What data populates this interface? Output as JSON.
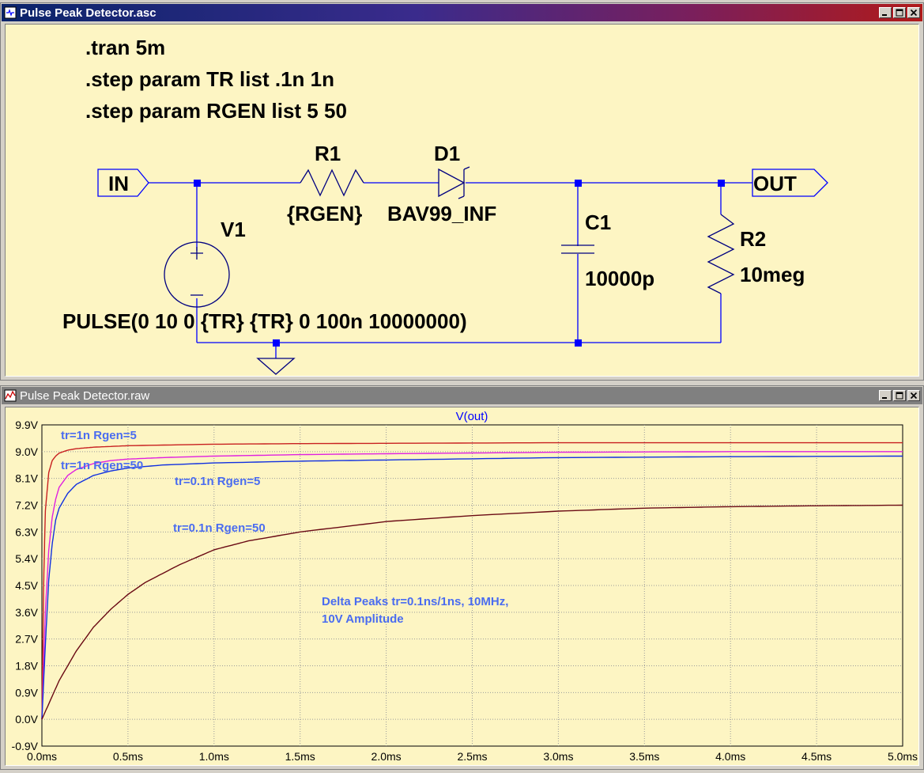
{
  "schematic": {
    "title": "Pulse Peak Detector.asc",
    "directives": [
      ".tran 5m",
      ".step param TR list .1n 1n",
      ".step param RGEN list 5 50"
    ],
    "in_label": "IN",
    "out_label": "OUT",
    "components": {
      "r1": {
        "ref": "R1",
        "value": "{RGEN}"
      },
      "d1": {
        "ref": "D1",
        "value": "BAV99_INF"
      },
      "c1": {
        "ref": "C1",
        "value": "10000p"
      },
      "r2": {
        "ref": "R2",
        "value": "10meg"
      },
      "v1": {
        "ref": "V1",
        "value": "PULSE(0 10 0 {TR} {TR} 0 100n 10000000)"
      }
    },
    "colors": {
      "background": "#fdf5c3",
      "wire": "#0000ff",
      "text": "#000000"
    }
  },
  "plot_window": {
    "title": "Pulse Peak Detector.raw",
    "trace_title": "V(out)",
    "curve_labels": [
      {
        "text": "tr=1n Rgen=5"
      },
      {
        "text": "tr=1n Rgen=50"
      },
      {
        "text": "tr=0.1n Rgen=5"
      },
      {
        "text": "tr=0.1n Rgen=50"
      }
    ],
    "annotation": [
      "Delta Peaks tr=0.1ns/1ns, 10MHz,",
      "10V Amplitude"
    ],
    "colors": {
      "label": "#4a6cf0",
      "title": "#0000ff",
      "grid": "#9a9a9a"
    }
  },
  "chart_data": {
    "type": "line",
    "title": "V(out)",
    "xlim": [
      0,
      5
    ],
    "ylim": [
      -0.9,
      9.9
    ],
    "x_ticks": [
      "0.0ms",
      "0.5ms",
      "1.0ms",
      "1.5ms",
      "2.0ms",
      "2.5ms",
      "3.0ms",
      "3.5ms",
      "4.0ms",
      "4.5ms",
      "5.0ms"
    ],
    "y_ticks": [
      "9.9V",
      "9.0V",
      "8.1V",
      "7.2V",
      "6.3V",
      "5.4V",
      "4.5V",
      "3.6V",
      "2.7V",
      "1.8V",
      "0.9V",
      "0.0V",
      "-0.9V"
    ],
    "grid": true,
    "series": [
      {
        "name": "tr=1n Rgen=5",
        "color": "#c82020",
        "x": [
          0,
          0.01,
          0.02,
          0.04,
          0.06,
          0.08,
          0.1,
          0.15,
          0.2,
          0.3,
          0.5,
          1.0,
          1.5,
          2.0,
          3.0,
          4.0,
          5.0
        ],
        "y": [
          0,
          4.5,
          7.0,
          8.3,
          8.7,
          8.85,
          8.95,
          9.05,
          9.1,
          9.15,
          9.2,
          9.25,
          9.27,
          9.28,
          9.3,
          9.3,
          9.3
        ]
      },
      {
        "name": "tr=1n Rgen=50",
        "color": "#e020e0",
        "x": [
          0,
          0.02,
          0.04,
          0.06,
          0.08,
          0.1,
          0.15,
          0.2,
          0.3,
          0.4,
          0.5,
          0.7,
          1.0,
          1.5,
          2.0,
          3.0,
          4.0,
          5.0
        ],
        "y": [
          0,
          3.6,
          5.7,
          6.8,
          7.4,
          7.8,
          8.2,
          8.4,
          8.6,
          8.7,
          8.75,
          8.8,
          8.85,
          8.9,
          8.93,
          8.98,
          9.0,
          9.0
        ]
      },
      {
        "name": "tr=0.1n Rgen=5",
        "color": "#1030e0",
        "x": [
          0,
          0.02,
          0.04,
          0.06,
          0.08,
          0.1,
          0.15,
          0.2,
          0.3,
          0.4,
          0.5,
          0.7,
          1.0,
          1.5,
          2.0,
          3.0,
          4.0,
          5.0
        ],
        "y": [
          0,
          2.5,
          4.7,
          5.9,
          6.7,
          7.1,
          7.6,
          7.9,
          8.2,
          8.35,
          8.45,
          8.55,
          8.62,
          8.68,
          8.72,
          8.8,
          8.83,
          8.85
        ]
      },
      {
        "name": "tr=0.1n Rgen=50",
        "color": "#6a0a14",
        "x": [
          0,
          0.1,
          0.2,
          0.3,
          0.4,
          0.5,
          0.6,
          0.8,
          1.0,
          1.2,
          1.5,
          2.0,
          2.5,
          3.0,
          3.5,
          4.0,
          4.5,
          5.0
        ],
        "y": [
          0,
          1.3,
          2.3,
          3.1,
          3.7,
          4.2,
          4.6,
          5.2,
          5.7,
          6.0,
          6.3,
          6.65,
          6.85,
          7.0,
          7.1,
          7.15,
          7.18,
          7.2
        ]
      }
    ]
  }
}
